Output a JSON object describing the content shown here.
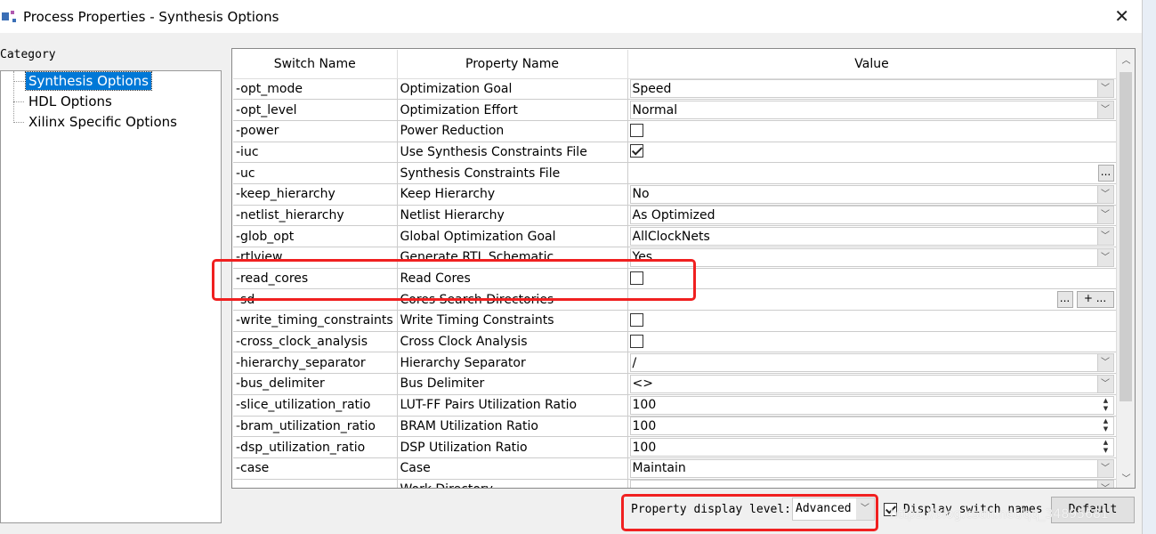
{
  "window": {
    "title": "Process Properties - Synthesis Options",
    "close": "✕"
  },
  "category": {
    "label": "Category",
    "items": [
      {
        "label": "Synthesis Options",
        "selected": true
      },
      {
        "label": "HDL Options"
      },
      {
        "label": "Xilinx Specific Options"
      }
    ]
  },
  "table": {
    "headers": [
      "Switch Name",
      "Property Name",
      "Value"
    ],
    "rows": [
      {
        "switch": "-opt_mode",
        "property": "Optimization Goal",
        "type": "dropdown",
        "value": "Speed"
      },
      {
        "switch": "-opt_level",
        "property": "Optimization Effort",
        "type": "dropdown",
        "value": "Normal"
      },
      {
        "switch": "-power",
        "property": "Power Reduction",
        "type": "checkbox",
        "checked": false
      },
      {
        "switch": "-iuc",
        "property": "Use Synthesis Constraints File",
        "type": "checkbox",
        "checked": true
      },
      {
        "switch": "-uc",
        "property": "Synthesis Constraints File",
        "type": "file",
        "value": "",
        "button": "..."
      },
      {
        "switch": "-keep_hierarchy",
        "property": "Keep Hierarchy",
        "type": "dropdown",
        "value": "No"
      },
      {
        "switch": "-netlist_hierarchy",
        "property": "Netlist Hierarchy",
        "type": "dropdown",
        "value": "As Optimized"
      },
      {
        "switch": "-glob_opt",
        "property": "Global Optimization Goal",
        "type": "dropdown",
        "value": "AllClockNets"
      },
      {
        "switch": "-rtlview",
        "property": "Generate RTL Schematic",
        "type": "dropdown",
        "value": "Yes"
      },
      {
        "switch": "-read_cores",
        "property": "Read Cores",
        "type": "checkbox",
        "checked": false
      },
      {
        "switch": "-sd",
        "property": "Cores Search Directories",
        "type": "dirs",
        "value": "",
        "button": "...",
        "button2": "+ ..."
      },
      {
        "switch": "-write_timing_constraints",
        "property": "Write Timing Constraints",
        "type": "checkbox",
        "checked": false
      },
      {
        "switch": "-cross_clock_analysis",
        "property": "Cross Clock Analysis",
        "type": "checkbox",
        "checked": false
      },
      {
        "switch": "-hierarchy_separator",
        "property": "Hierarchy Separator",
        "type": "dropdown",
        "value": "/"
      },
      {
        "switch": "-bus_delimiter",
        "property": "Bus Delimiter",
        "type": "dropdown",
        "value": "<>"
      },
      {
        "switch": "-slice_utilization_ratio",
        "property": "LUT-FF Pairs Utilization Ratio",
        "type": "spin",
        "value": "100"
      },
      {
        "switch": "-bram_utilization_ratio",
        "property": "BRAM Utilization Ratio",
        "type": "spin",
        "value": "100"
      },
      {
        "switch": "-dsp_utilization_ratio",
        "property": "DSP Utilization Ratio",
        "type": "spin",
        "value": "100"
      },
      {
        "switch": "-case",
        "property": "Case",
        "type": "dropdown",
        "value": "Maintain"
      },
      {
        "switch": "",
        "property": "Work Directory",
        "type": "dropdown",
        "value": ""
      }
    ]
  },
  "footer": {
    "display_level_label": "Property display level:",
    "display_level_value": "Advanced",
    "display_switch_label": "Display switch names",
    "display_switch_checked": true,
    "default_button": "Default"
  },
  "watermark": "https://blog.csdn.net/qq_34895681",
  "colors": {
    "selection": "#0078d7",
    "highlight": "#f02020"
  }
}
